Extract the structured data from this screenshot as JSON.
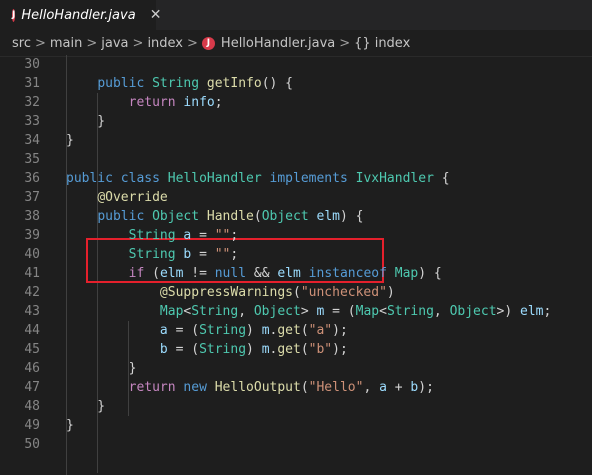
{
  "tab": {
    "title": "HelloHandler.java",
    "icon_letter": "J",
    "close_glyph": "✕"
  },
  "breadcrumb": {
    "items": [
      "src",
      "main",
      "java",
      "index"
    ],
    "file": "HelloHandler.java",
    "symbol_icon": "{}",
    "symbol": "index",
    "separator": ">"
  },
  "colors": {
    "keyword": "#569cd6",
    "control": "#c586c0",
    "type": "#4ec9b0",
    "function": "#dcdcaa",
    "variable": "#9cdcfe",
    "string": "#ce9178",
    "highlight_border": "#e5202c"
  },
  "code": {
    "lines": [
      {
        "n": "30",
        "tokens": []
      },
      {
        "n": "31",
        "tokens": [
          [
            "pl",
            "    "
          ],
          [
            "kw",
            "public"
          ],
          [
            "pl",
            " "
          ],
          [
            "ty",
            "String"
          ],
          [
            "pl",
            " "
          ],
          [
            "fn",
            "getInfo"
          ],
          [
            "pl",
            "() {"
          ]
        ]
      },
      {
        "n": "32",
        "tokens": [
          [
            "pl",
            "        "
          ],
          [
            "ctl",
            "return"
          ],
          [
            "pl",
            " "
          ],
          [
            "var",
            "info"
          ],
          [
            "pl",
            ";"
          ]
        ]
      },
      {
        "n": "33",
        "tokens": [
          [
            "pl",
            "    }"
          ]
        ]
      },
      {
        "n": "34",
        "tokens": [
          [
            "pl",
            "}"
          ]
        ]
      },
      {
        "n": "35",
        "tokens": []
      },
      {
        "n": "36",
        "tokens": [
          [
            "kw",
            "public"
          ],
          [
            "pl",
            " "
          ],
          [
            "kw",
            "class"
          ],
          [
            "pl",
            " "
          ],
          [
            "ty",
            "HelloHandler"
          ],
          [
            "pl",
            " "
          ],
          [
            "kw",
            "implements"
          ],
          [
            "pl",
            " "
          ],
          [
            "ty",
            "IvxHandler"
          ],
          [
            "pl",
            " {"
          ]
        ]
      },
      {
        "n": "37",
        "tokens": [
          [
            "pl",
            "    "
          ],
          [
            "ann",
            "@Override"
          ]
        ]
      },
      {
        "n": "38",
        "tokens": [
          [
            "pl",
            "    "
          ],
          [
            "kw",
            "public"
          ],
          [
            "pl",
            " "
          ],
          [
            "ty",
            "Object"
          ],
          [
            "pl",
            " "
          ],
          [
            "fn",
            "Handle"
          ],
          [
            "pl",
            "("
          ],
          [
            "ty",
            "Object"
          ],
          [
            "pl",
            " "
          ],
          [
            "var",
            "elm"
          ],
          [
            "pl",
            ") {"
          ]
        ]
      },
      {
        "n": "39",
        "tokens": [
          [
            "pl",
            "        "
          ],
          [
            "ty",
            "String"
          ],
          [
            "pl",
            " "
          ],
          [
            "var",
            "a"
          ],
          [
            "pl",
            " = "
          ],
          [
            "str",
            "\"\""
          ],
          [
            "pl",
            ";"
          ]
        ]
      },
      {
        "n": "40",
        "tokens": [
          [
            "pl",
            "        "
          ],
          [
            "ty",
            "String"
          ],
          [
            "pl",
            " "
          ],
          [
            "var",
            "b"
          ],
          [
            "pl",
            " = "
          ],
          [
            "str",
            "\"\""
          ],
          [
            "pl",
            ";"
          ]
        ]
      },
      {
        "n": "41",
        "tokens": [
          [
            "pl",
            "        "
          ],
          [
            "ctl",
            "if"
          ],
          [
            "pl",
            " ("
          ],
          [
            "var",
            "elm"
          ],
          [
            "pl",
            " != "
          ],
          [
            "kw",
            "null"
          ],
          [
            "pl",
            " && "
          ],
          [
            "var",
            "elm"
          ],
          [
            "pl",
            " "
          ],
          [
            "kw",
            "instanceof"
          ],
          [
            "pl",
            " "
          ],
          [
            "ty",
            "Map"
          ],
          [
            "pl",
            ") {"
          ]
        ]
      },
      {
        "n": "42",
        "tokens": [
          [
            "pl",
            "            "
          ],
          [
            "ann",
            "@SuppressWarnings"
          ],
          [
            "pl",
            "("
          ],
          [
            "str",
            "\"unchecked\""
          ],
          [
            "pl",
            ")"
          ]
        ]
      },
      {
        "n": "43",
        "tokens": [
          [
            "pl",
            "            "
          ],
          [
            "ty",
            "Map"
          ],
          [
            "pl",
            "<"
          ],
          [
            "ty",
            "String"
          ],
          [
            "pl",
            ", "
          ],
          [
            "ty",
            "Object"
          ],
          [
            "pl",
            "> "
          ],
          [
            "var",
            "m"
          ],
          [
            "pl",
            " = ("
          ],
          [
            "ty",
            "Map"
          ],
          [
            "pl",
            "<"
          ],
          [
            "ty",
            "String"
          ],
          [
            "pl",
            ", "
          ],
          [
            "ty",
            "Object"
          ],
          [
            "pl",
            ">) "
          ],
          [
            "var",
            "elm"
          ],
          [
            "pl",
            ";"
          ]
        ]
      },
      {
        "n": "44",
        "tokens": [
          [
            "pl",
            "            "
          ],
          [
            "var",
            "a"
          ],
          [
            "pl",
            " = ("
          ],
          [
            "ty",
            "String"
          ],
          [
            "pl",
            ") "
          ],
          [
            "var",
            "m"
          ],
          [
            "pl",
            "."
          ],
          [
            "fn",
            "get"
          ],
          [
            "pl",
            "("
          ],
          [
            "str",
            "\"a\""
          ],
          [
            "pl",
            ");"
          ]
        ]
      },
      {
        "n": "45",
        "tokens": [
          [
            "pl",
            "            "
          ],
          [
            "var",
            "b"
          ],
          [
            "pl",
            " = ("
          ],
          [
            "ty",
            "String"
          ],
          [
            "pl",
            ") "
          ],
          [
            "var",
            "m"
          ],
          [
            "pl",
            "."
          ],
          [
            "fn",
            "get"
          ],
          [
            "pl",
            "("
          ],
          [
            "str",
            "\"b\""
          ],
          [
            "pl",
            ");"
          ]
        ]
      },
      {
        "n": "46",
        "tokens": [
          [
            "pl",
            "        }"
          ]
        ]
      },
      {
        "n": "47",
        "tokens": [
          [
            "pl",
            "        "
          ],
          [
            "ctl",
            "return"
          ],
          [
            "pl",
            " "
          ],
          [
            "kw",
            "new"
          ],
          [
            "pl",
            " "
          ],
          [
            "fn",
            "HelloOutput"
          ],
          [
            "pl",
            "("
          ],
          [
            "str",
            "\"Hello\""
          ],
          [
            "pl",
            ", "
          ],
          [
            "var",
            "a"
          ],
          [
            "pl",
            " + "
          ],
          [
            "var",
            "b"
          ],
          [
            "pl",
            ");"
          ]
        ]
      },
      {
        "n": "48",
        "tokens": [
          [
            "pl",
            "    }"
          ]
        ]
      },
      {
        "n": "49",
        "tokens": [
          [
            "pl",
            "}"
          ]
        ]
      },
      {
        "n": "50",
        "tokens": []
      }
    ]
  }
}
